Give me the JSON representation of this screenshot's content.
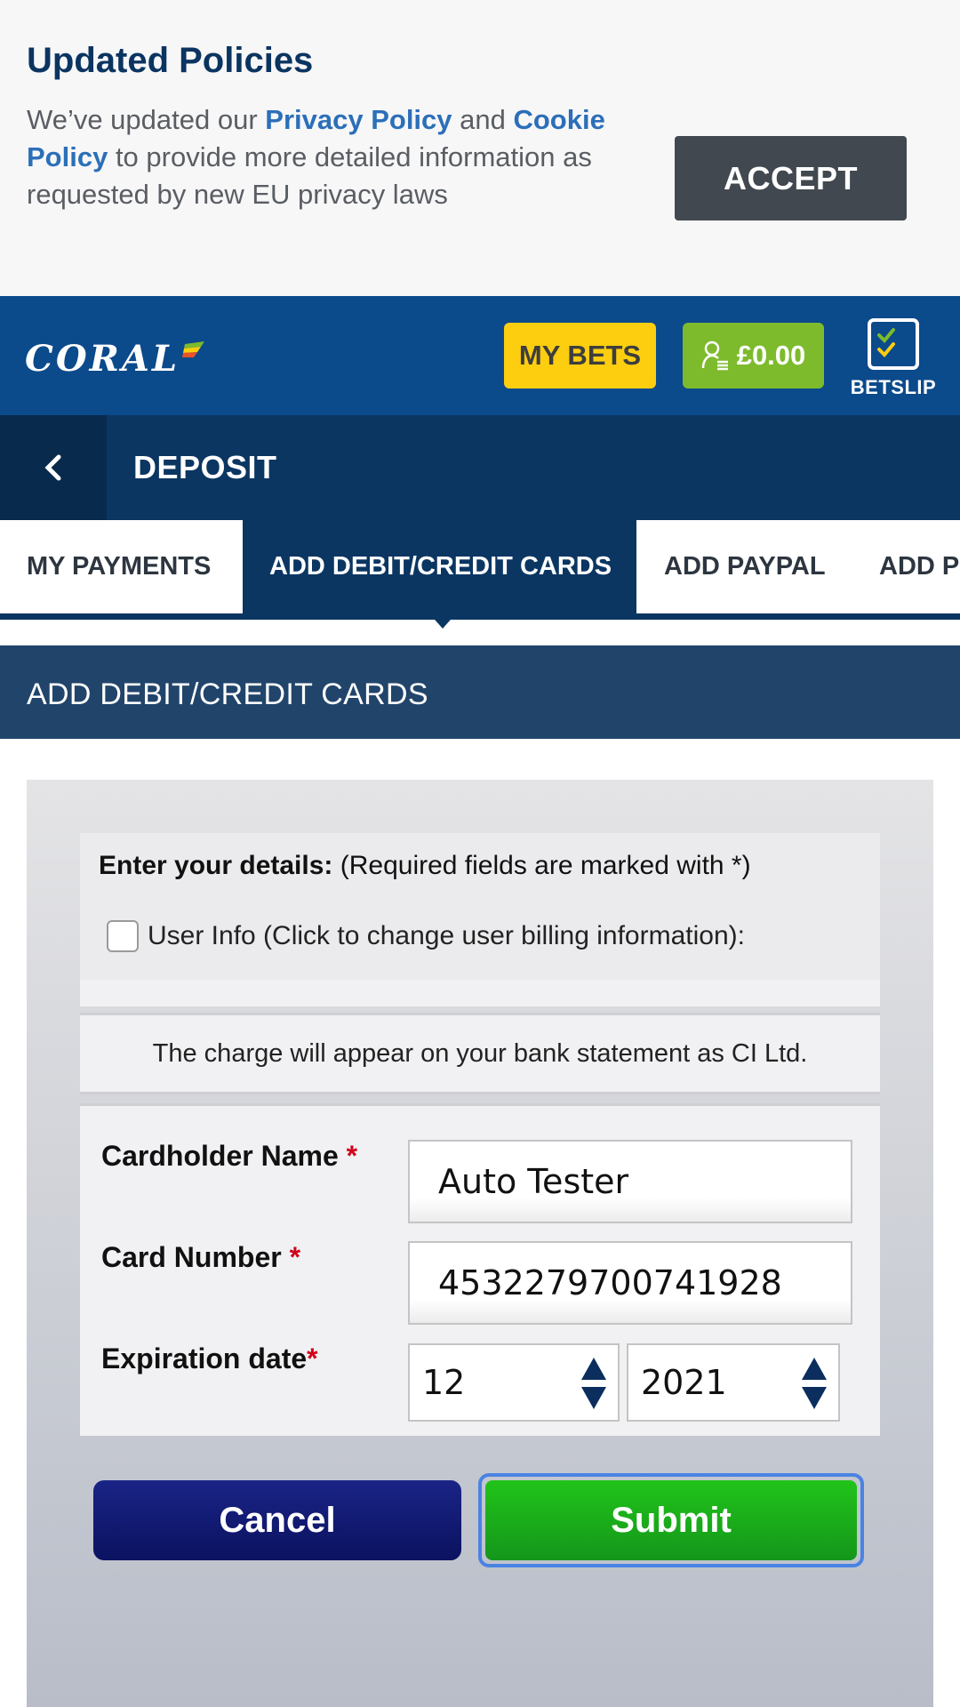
{
  "policy": {
    "title": "Updated Policies",
    "text_prefix": "We’ve updated our ",
    "privacy_link": "Privacy Policy",
    "text_and": " and ",
    "cookie_link": "Cookie Policy",
    "text_suffix": " to provide more detailed information as requested by new EU privacy laws",
    "accept_label": "ACCEPT"
  },
  "header": {
    "logo_text": "CORAL",
    "my_bets_label": "MY BETS",
    "balance": "£0.00",
    "betslip_label": "BETSLIP"
  },
  "page": {
    "title": "DEPOSIT"
  },
  "tabs": [
    {
      "label": "MY PAYMENTS",
      "active": false
    },
    {
      "label": "ADD DEBIT/CREDIT CARDS",
      "active": true
    },
    {
      "label": "ADD PAYPAL",
      "active": false
    },
    {
      "label": "ADD P",
      "active": false
    }
  ],
  "section": {
    "title": "ADD DEBIT/CREDIT CARDS"
  },
  "form": {
    "enter_details_bold": "Enter your details:",
    "enter_details_note": " (Required fields are marked with *)",
    "user_info_label": "User Info (Click to change user billing information):",
    "user_info_checked": false,
    "charge_notice": "The charge will appear on your bank statement as CI Ltd.",
    "cardholder_label": "Cardholder Name",
    "cardholder_value": "Auto Tester",
    "card_number_label": "Card Number",
    "card_number_value": "4532279700741928",
    "expiration_label": "Expiration date",
    "exp_month": "12",
    "exp_year": "2021",
    "required_mark": "*",
    "cancel_label": "Cancel",
    "submit_label": "Submit"
  },
  "colors": {
    "brand_blue": "#0b4a8b",
    "navy": "#0b3662",
    "my_bets_yellow": "#fcce0f",
    "balance_green": "#7dbb2d",
    "submit_green": "#1aab1a",
    "cancel_navy": "#121a70",
    "link_blue": "#2c6fb8"
  },
  "icons": [
    "user-balance-icon",
    "betslip-check-icon",
    "chevron-left-icon",
    "coral-flag-icon",
    "spinner-arrows-icon"
  ]
}
